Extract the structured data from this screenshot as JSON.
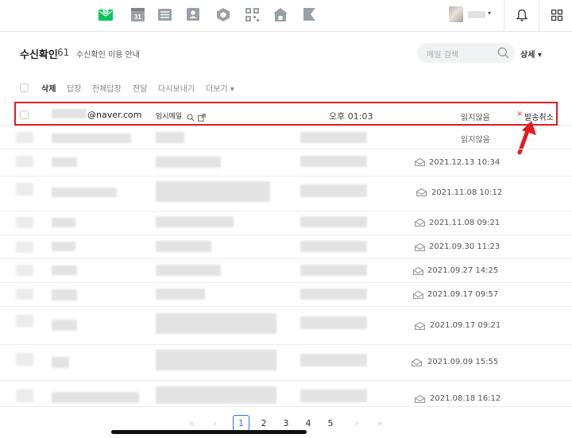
{
  "header": {
    "apps": [
      "mail-app-icon",
      "calendar-icon",
      "contacts-list-icon",
      "address-book-icon",
      "office-icon",
      "qr-apps-icon",
      "home-icon",
      "bookmark-icon"
    ],
    "calendar_day": "31",
    "mail_badge": "N"
  },
  "page": {
    "title": "수신확인",
    "count": "61",
    "guide_link": "수신확인 이용 안내",
    "search_placeholder": "메일 검색",
    "detail_button": "상세 ▾"
  },
  "toolbar": {
    "delete": "삭제",
    "reply": "답장",
    "reply_all": "전체답장",
    "forward": "전달",
    "resend": "다시보내기",
    "more": "더보기 ▾"
  },
  "first_row": {
    "recipient": "@naver.com",
    "subject": "임시메일",
    "time": "오후 01:03",
    "status": "읽지않음",
    "cancel_label": "발송취소",
    "cancel_mark": "×"
  },
  "rows": [
    {
      "status": "읽지않음",
      "date": ""
    },
    {
      "status": "",
      "date": "2021.12.13 10:34"
    },
    {
      "status": "",
      "date": "2021.11.08 10:12"
    },
    {
      "status": "",
      "date": "2021.11.08 09:21"
    },
    {
      "status": "",
      "date": "2021.09.30 11:23"
    },
    {
      "status": "",
      "date": "2021.09.27 14:25"
    },
    {
      "status": "",
      "date": "2021.09.17 09:57"
    },
    {
      "status": "",
      "date": "2021.09.17 09:21"
    },
    {
      "status": "",
      "date": "2021.09.09 15:55"
    },
    {
      "status": "",
      "date": "2021.08.18 16:12"
    }
  ],
  "pagination": {
    "first": "«",
    "prev": "‹",
    "pages": [
      "1",
      "2",
      "3",
      "4",
      "5"
    ],
    "current": "1",
    "next": "›",
    "last": "»"
  },
  "colors": {
    "highlight": "#e31b23",
    "mail_green": "#03c75a",
    "current_page": "#2f6fe8"
  }
}
